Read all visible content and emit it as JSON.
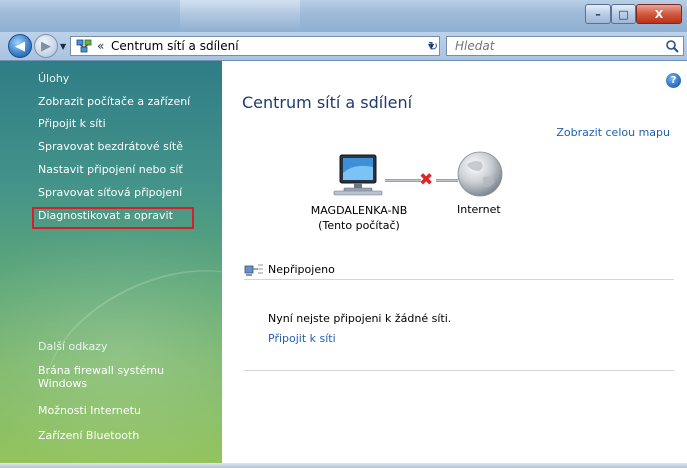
{
  "window": {
    "minimize_label": "–",
    "maximize_label": "□",
    "close_label": "X"
  },
  "addressbar": {
    "back_glyph": "◀",
    "forward_glyph": "▶",
    "chevron": "«",
    "path": "Centrum sítí a sdílení",
    "refresh_glyph": "↻",
    "search_placeholder": "Hledat"
  },
  "sidebar": {
    "tasks_heading": "Úlohy",
    "tasks": [
      "Zobrazit počítače a zařízení",
      "Připojit k síti",
      "Spravovat bezdrátové sítě",
      "Nastavit připojení nebo síť",
      "Spravovat síťová připojení",
      "Diagnostikovat a opravit"
    ],
    "more_heading": "Další odkazy",
    "more_links": [
      "Brána firewall systému Windows",
      "Možnosti Internetu",
      "Zařízení Bluetooth"
    ]
  },
  "main": {
    "help_glyph": "?",
    "title": "Centrum sítí a sdílení",
    "full_map_link": "Zobrazit celou mapu",
    "computer_name": "MAGDALENKA-NB",
    "computer_note": "(Tento počítač)",
    "x_glyph": "✖",
    "internet_label": "Internet",
    "status": "Nepřipojeno",
    "message": "Nyní nejste připojeni k žádné síti.",
    "connect_link": "Připojit k síti"
  }
}
